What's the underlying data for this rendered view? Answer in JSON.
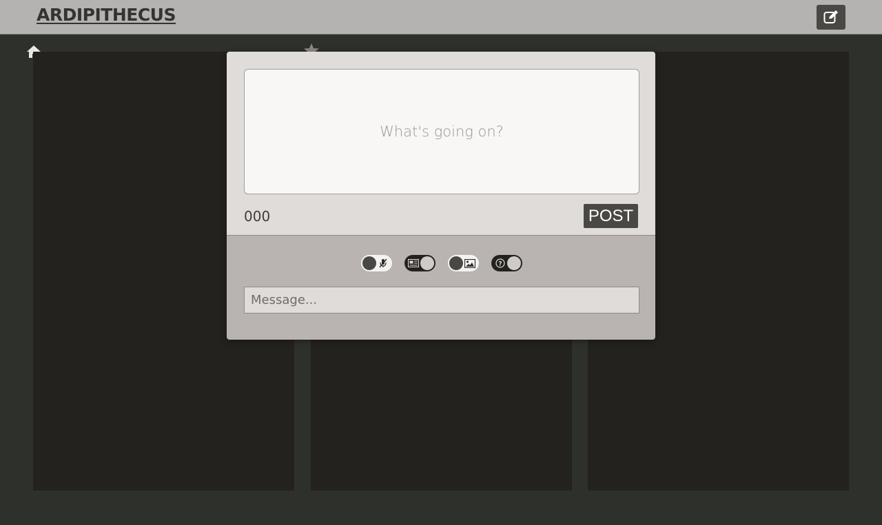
{
  "header": {
    "logo": "ARDIPITHECUS",
    "compose_icon": "compose-edit-icon"
  },
  "nav": {
    "home_icon": "home-icon",
    "star_icon": "star-icon"
  },
  "composer": {
    "post_placeholder": "What's going on?",
    "char_count": "000",
    "post_label": "POST",
    "message_placeholder": "Message...",
    "toggles": [
      {
        "name": "mute-toggle",
        "icon": "mic-off-icon",
        "state": "off"
      },
      {
        "name": "newspaper-toggle",
        "icon": "newspaper-icon",
        "state": "on"
      },
      {
        "name": "image-toggle",
        "icon": "image-icon",
        "state": "off"
      },
      {
        "name": "question-toggle",
        "icon": "question-icon",
        "state": "on"
      }
    ]
  },
  "colors": {
    "header_bg": "#b5b3b1",
    "page_bg": "#2e302c",
    "column_bg": "#24221f",
    "modal_top_bg": "#e0dcd9",
    "modal_bottom_bg": "#b9b4b1",
    "button_bg": "#4a4844"
  }
}
